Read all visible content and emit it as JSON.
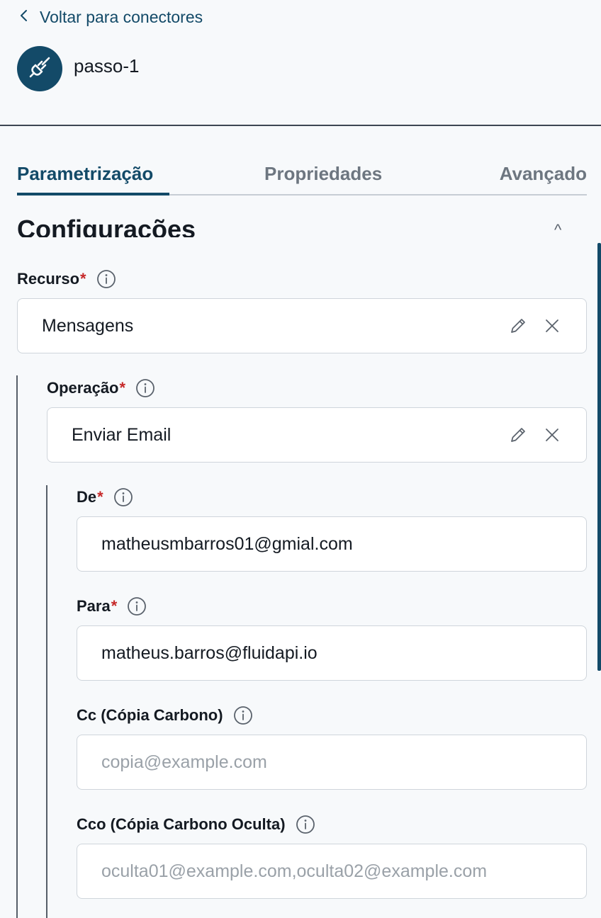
{
  "header": {
    "back_label": "Voltar para conectores",
    "connector_name": "passo-1",
    "connector_icon": "plug-icon"
  },
  "tabs": [
    {
      "label": "Parametrização",
      "active": true
    },
    {
      "label": "Propriedades",
      "active": false
    },
    {
      "label": "Avançado",
      "active": false
    }
  ],
  "section": {
    "title": "Configurações",
    "collapse_glyph": "^"
  },
  "fields": {
    "recurso": {
      "label": "Recurso",
      "required_mark": "*",
      "value": "Mensagens"
    },
    "operacao": {
      "label": "Operação",
      "required_mark": "*",
      "value": "Enviar Email"
    },
    "de": {
      "label": "De",
      "required_mark": "*",
      "value": "matheusmbarros01@gmial.com"
    },
    "para": {
      "label": "Para",
      "required_mark": "*",
      "value": "matheus.barros@fluidapi.io"
    },
    "cc": {
      "label": "Cc (Cópia Carbono)",
      "value": "",
      "placeholder": "copia@example.com"
    },
    "cco": {
      "label": "Cco (Cópia Carbono Oculta)",
      "value": "",
      "placeholder": "oculta01@example.com,oculta02@example.com"
    }
  },
  "colors": {
    "primary": "#134a68",
    "required": "#c62828",
    "background": "#f7f9fb"
  }
}
